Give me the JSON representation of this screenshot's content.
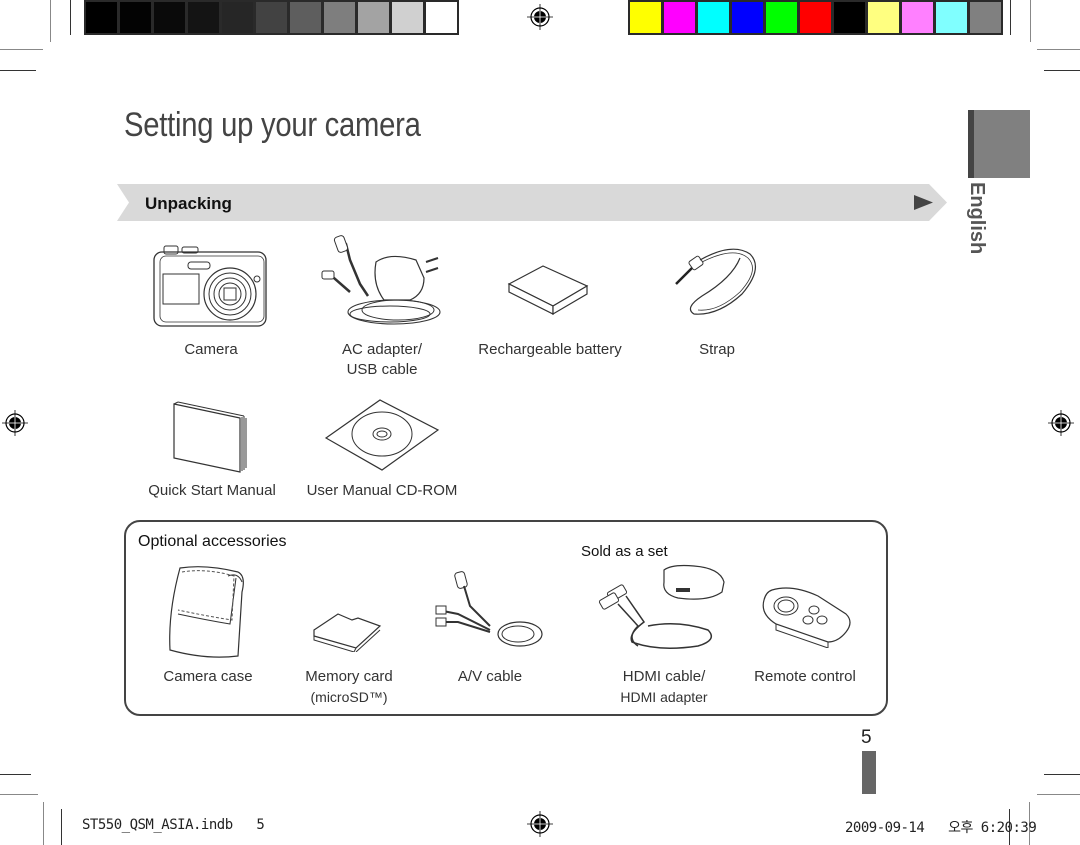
{
  "print_marks": {
    "grayscale_swatches": [
      "#000000",
      "#030303",
      "#0a0a0a",
      "#141414",
      "#262626",
      "#424242",
      "#5e5e5e",
      "#7e7e7e",
      "#a3a3a3",
      "#d0d0d0",
      "#ffffff"
    ],
    "color_swatches": [
      "#ffff00",
      "#ff00ff",
      "#00ffff",
      "#0000ff",
      "#00ff00",
      "#ff0000",
      "#000000",
      "#ffff80",
      "#ff80ff",
      "#80ffff",
      "#808080"
    ]
  },
  "page": {
    "title": "Setting up your camera",
    "language_tab": "English",
    "page_number": "5",
    "colors": {
      "banner": "#d9d9d9",
      "tab": "#808080",
      "arrow": "#444444"
    }
  },
  "unpacking": {
    "heading": "Unpacking",
    "items": [
      {
        "icon": "camera-icon",
        "label": "Camera"
      },
      {
        "icon": "ac-adapter-usb-cable-icon",
        "label_line1": "AC adapter/",
        "label_line2": "USB cable"
      },
      {
        "icon": "battery-icon",
        "label": "Rechargeable battery"
      },
      {
        "icon": "strap-icon",
        "label": "Strap"
      },
      {
        "icon": "manual-booklet-icon",
        "label": "Quick Start Manual"
      },
      {
        "icon": "cd-rom-icon",
        "label": "User Manual CD-ROM"
      }
    ]
  },
  "optional_accessories": {
    "heading": "Optional accessories",
    "set_note": "Sold as a set",
    "items": [
      {
        "icon": "camera-case-icon",
        "label": "Camera case"
      },
      {
        "icon": "memory-card-icon",
        "label_line1": "Memory card",
        "label_line2": "(microSD™)"
      },
      {
        "icon": "av-cable-icon",
        "label": "A/V cable"
      },
      {
        "icon": "hdmi-cable-adapter-icon",
        "label_line1": "HDMI cable/",
        "label_line2": "HDMI adapter"
      },
      {
        "icon": "remote-control-icon",
        "label": "Remote control"
      }
    ]
  },
  "footer": {
    "file_info": "ST550_QSM_ASIA.indb   5",
    "timestamp": "2009-09-14   오후 6:20:39"
  }
}
